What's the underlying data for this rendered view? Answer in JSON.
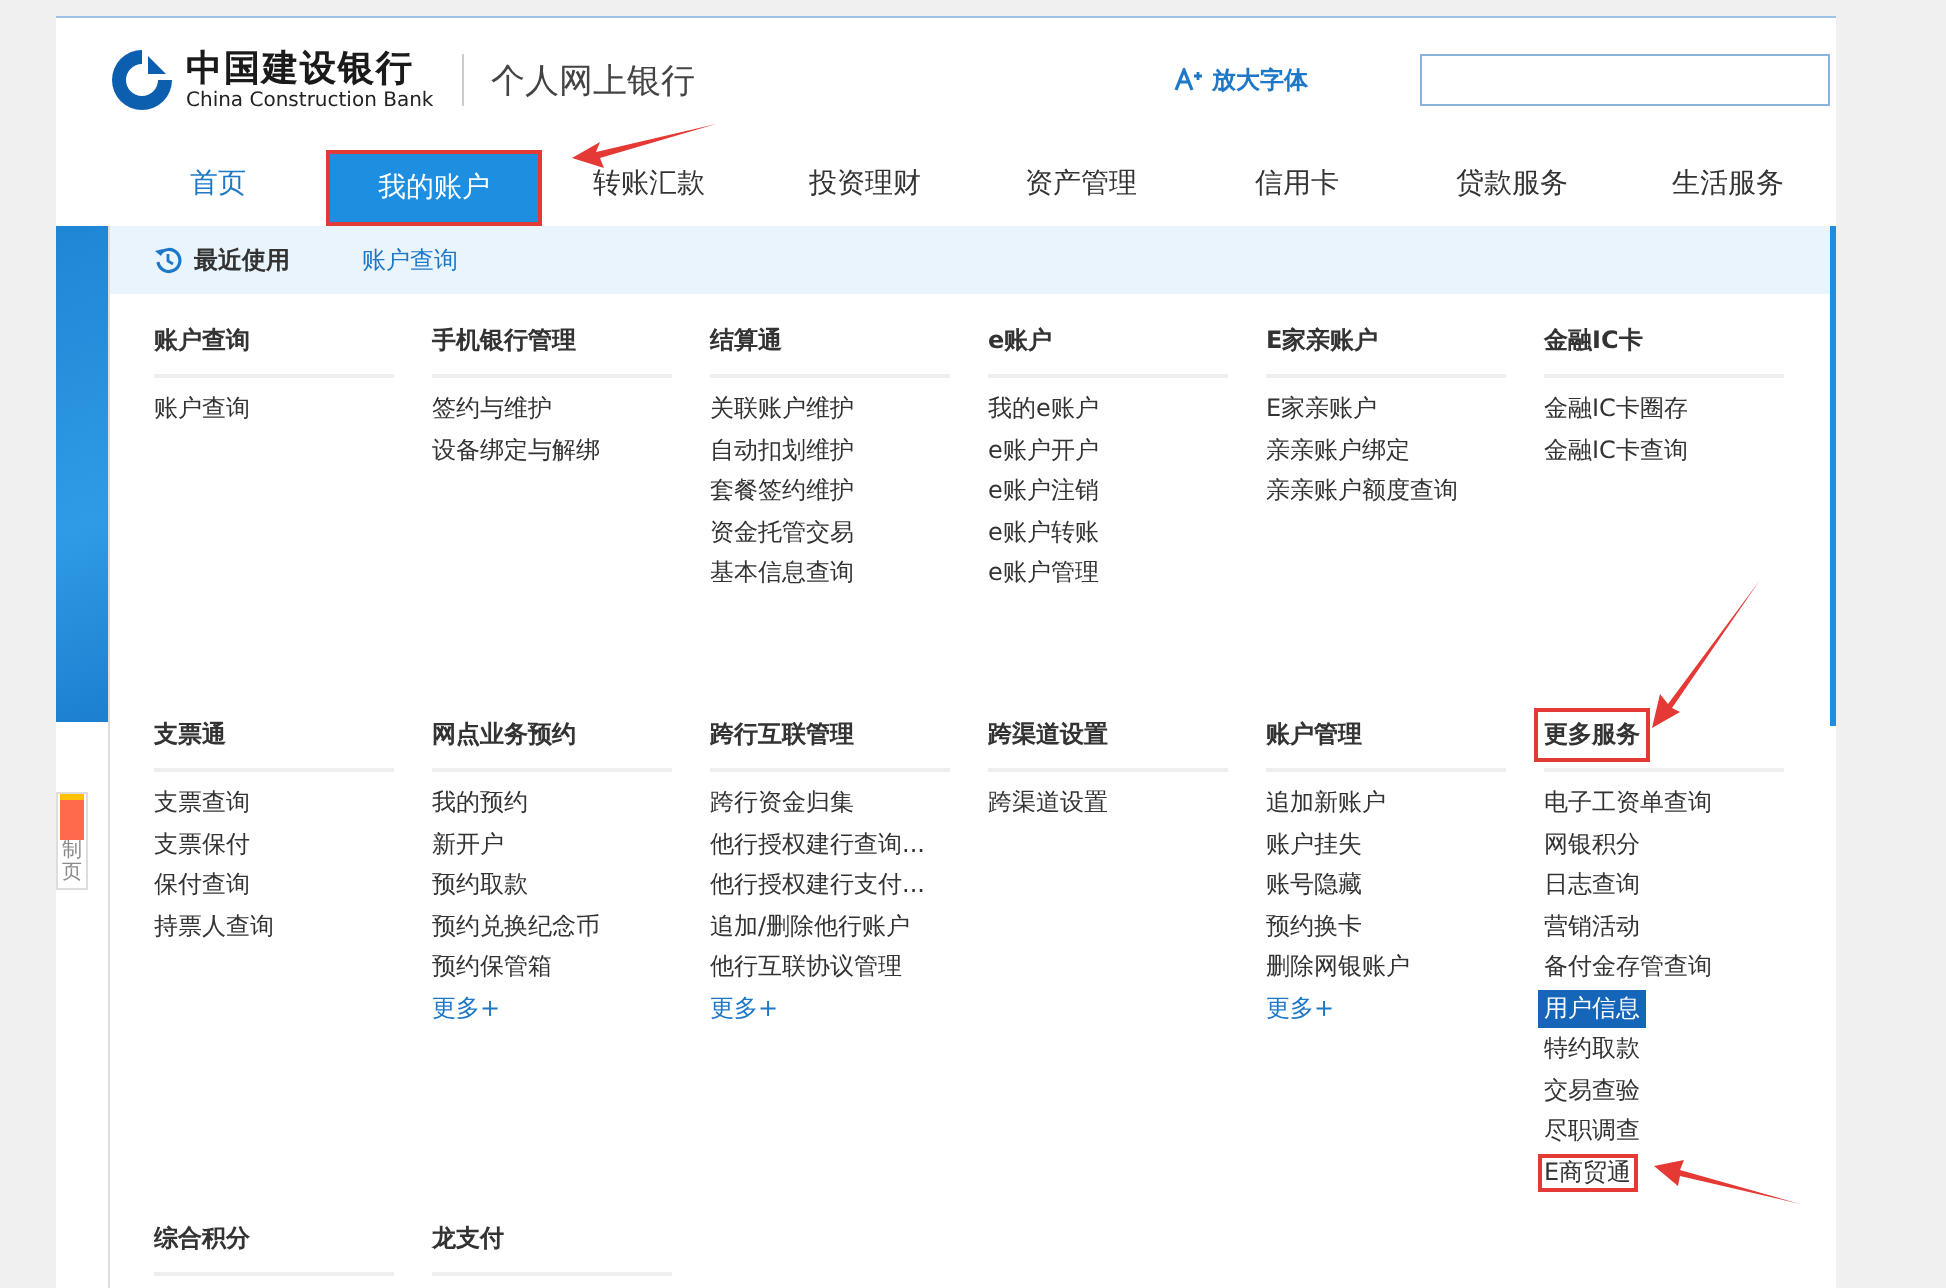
{
  "header": {
    "bank_name": "中国建设银行",
    "bank_name_en": "China Construction Bank",
    "site_title": "个人网上银行",
    "font_button": "放大字体"
  },
  "nav": [
    {
      "label": "首页",
      "selected": false,
      "boxed": false
    },
    {
      "label": "我的账户",
      "selected": true,
      "boxed": true
    },
    {
      "label": "转账汇款",
      "selected": false,
      "boxed": false
    },
    {
      "label": "投资理财",
      "selected": false,
      "boxed": false
    },
    {
      "label": "资产管理",
      "selected": false,
      "boxed": false
    },
    {
      "label": "信用卡",
      "selected": false,
      "boxed": false
    },
    {
      "label": "贷款服务",
      "selected": false,
      "boxed": false
    },
    {
      "label": "生活服务",
      "selected": false,
      "boxed": false
    }
  ],
  "recent": {
    "label": "最近使用",
    "links": [
      "账户查询"
    ]
  },
  "side_tab": {
    "text": "制页"
  },
  "menu_rows": [
    {
      "groups": [
        {
          "heading": "账户查询",
          "boxed": false,
          "items": [
            {
              "text": "账户查询",
              "selected": false,
              "boxed": false
            }
          ]
        },
        {
          "heading": "手机银行管理",
          "boxed": false,
          "items": [
            {
              "text": "签约与维护",
              "selected": false,
              "boxed": false
            },
            {
              "text": "设备绑定与解绑",
              "selected": false,
              "boxed": false
            }
          ]
        },
        {
          "heading": "结算通",
          "boxed": false,
          "items": [
            {
              "text": "关联账户维护",
              "selected": false,
              "boxed": false
            },
            {
              "text": "自动扣划维护",
              "selected": false,
              "boxed": false
            },
            {
              "text": "套餐签约维护",
              "selected": false,
              "boxed": false
            },
            {
              "text": "资金托管交易",
              "selected": false,
              "boxed": false
            },
            {
              "text": "基本信息查询",
              "selected": false,
              "boxed": false
            }
          ]
        },
        {
          "heading": "e账户",
          "boxed": false,
          "items": [
            {
              "text": "我的e账户",
              "selected": false,
              "boxed": false
            },
            {
              "text": "e账户开户",
              "selected": false,
              "boxed": false
            },
            {
              "text": "e账户注销",
              "selected": false,
              "boxed": false
            },
            {
              "text": "e账户转账",
              "selected": false,
              "boxed": false
            },
            {
              "text": "e账户管理",
              "selected": false,
              "boxed": false
            }
          ]
        },
        {
          "heading": "E家亲账户",
          "boxed": false,
          "items": [
            {
              "text": "E家亲账户",
              "selected": false,
              "boxed": false
            },
            {
              "text": "亲亲账户绑定",
              "selected": false,
              "boxed": false
            },
            {
              "text": "亲亲账户额度查询",
              "selected": false,
              "boxed": false
            }
          ]
        },
        {
          "heading": "金融IC卡",
          "boxed": false,
          "items": [
            {
              "text": "金融IC卡圈存",
              "selected": false,
              "boxed": false
            },
            {
              "text": "金融IC卡查询",
              "selected": false,
              "boxed": false
            }
          ]
        }
      ]
    },
    {
      "groups": [
        {
          "heading": "支票通",
          "boxed": false,
          "items": [
            {
              "text": "支票查询",
              "selected": false,
              "boxed": false
            },
            {
              "text": "支票保付",
              "selected": false,
              "boxed": false
            },
            {
              "text": "保付查询",
              "selected": false,
              "boxed": false
            },
            {
              "text": "持票人查询",
              "selected": false,
              "boxed": false
            }
          ]
        },
        {
          "heading": "网点业务预约",
          "boxed": false,
          "items": [
            {
              "text": "我的预约",
              "selected": false,
              "boxed": false
            },
            {
              "text": "新开户",
              "selected": false,
              "boxed": false
            },
            {
              "text": "预约取款",
              "selected": false,
              "boxed": false
            },
            {
              "text": "预约兑换纪念币",
              "selected": false,
              "boxed": false
            },
            {
              "text": "预约保管箱",
              "selected": false,
              "boxed": false
            }
          ],
          "more": "更多+"
        },
        {
          "heading": "跨行互联管理",
          "boxed": false,
          "items": [
            {
              "text": "跨行资金归集",
              "selected": false,
              "boxed": false
            },
            {
              "text": "他行授权建行查询...",
              "selected": false,
              "boxed": false
            },
            {
              "text": "他行授权建行支付...",
              "selected": false,
              "boxed": false
            },
            {
              "text": "追加/删除他行账户",
              "selected": false,
              "boxed": false
            },
            {
              "text": "他行互联协议管理",
              "selected": false,
              "boxed": false
            }
          ],
          "more": "更多+"
        },
        {
          "heading": "跨渠道设置",
          "boxed": false,
          "items": [
            {
              "text": "跨渠道设置",
              "selected": false,
              "boxed": false
            }
          ]
        },
        {
          "heading": "账户管理",
          "boxed": false,
          "items": [
            {
              "text": "追加新账户",
              "selected": false,
              "boxed": false
            },
            {
              "text": "账户挂失",
              "selected": false,
              "boxed": false
            },
            {
              "text": "账号隐藏",
              "selected": false,
              "boxed": false
            },
            {
              "text": "预约换卡",
              "selected": false,
              "boxed": false
            },
            {
              "text": "删除网银账户",
              "selected": false,
              "boxed": false
            }
          ],
          "more": "更多+"
        },
        {
          "heading": "更多服务",
          "boxed": true,
          "items": [
            {
              "text": "电子工资单查询",
              "selected": false,
              "boxed": false
            },
            {
              "text": "网银积分",
              "selected": false,
              "boxed": false
            },
            {
              "text": "日志查询",
              "selected": false,
              "boxed": false
            },
            {
              "text": "营销活动",
              "selected": false,
              "boxed": false
            },
            {
              "text": "备付金存管查询",
              "selected": false,
              "boxed": false
            },
            {
              "text": "用户信息",
              "selected": true,
              "boxed": false
            },
            {
              "text": "特约取款",
              "selected": false,
              "boxed": false
            },
            {
              "text": "交易查验",
              "selected": false,
              "boxed": false
            },
            {
              "text": "尽职调查",
              "selected": false,
              "boxed": false
            },
            {
              "text": "E商贸通",
              "selected": false,
              "boxed": true
            }
          ]
        }
      ]
    },
    {
      "groups": [
        {
          "heading": "综合积分",
          "boxed": false
        },
        {
          "heading": "龙支付",
          "boxed": false
        }
      ]
    }
  ]
}
